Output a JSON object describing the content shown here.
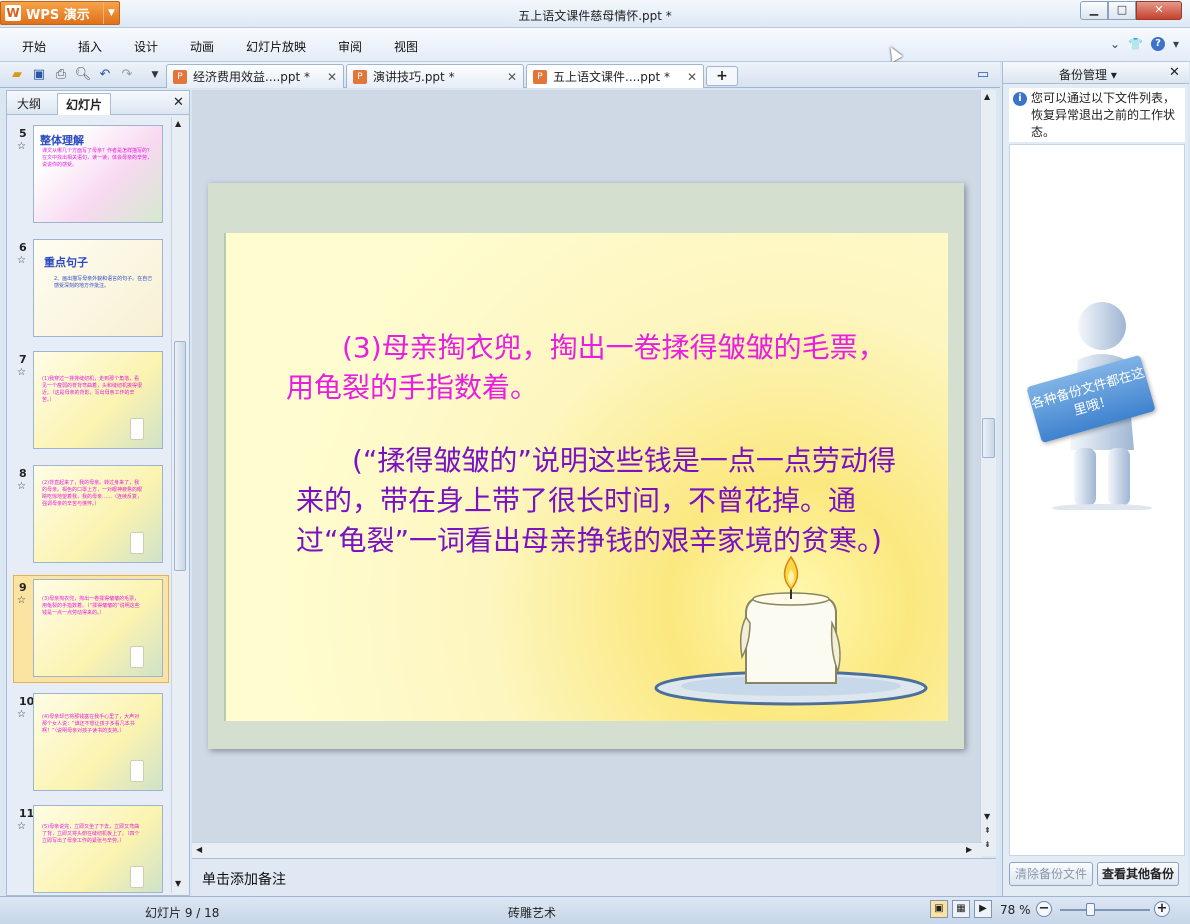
{
  "app": {
    "name": "WPS 演示",
    "document_title": "五上语文课件慈母情怀.ppt *"
  },
  "window_buttons": {
    "minimize": "▁",
    "maximize": "□",
    "close": "✕"
  },
  "menu": [
    "开始",
    "插入",
    "设计",
    "动画",
    "幻灯片放映",
    "审阅",
    "视图"
  ],
  "tabs": [
    {
      "label": "经济费用效益....ppt *"
    },
    {
      "label": "演讲技巧.ppt *"
    },
    {
      "label": "五上语文课件....ppt *"
    }
  ],
  "tab_add": "+",
  "left_pane": {
    "tabs": [
      "大纲",
      "幻灯片"
    ],
    "thumbnails": [
      {
        "number": "5",
        "heading": "整体理解",
        "body": "课文从哪几个方面写了母亲？作者是怎样描写的？在文中找出相关语句，读一读，体会母亲的辛劳，说说你的感受。"
      },
      {
        "number": "6",
        "heading": "重点句子",
        "body": "2、画出描写母亲外貌和语言的句子。在自己感受深刻的地方作批注。"
      },
      {
        "number": "7",
        "heading": "",
        "body": "(1)我穿过一排排缝纫机，走到那个角落，看见一个瘦弱的脊背弯曲着，头和缝纫机挨得很近。（这是母亲的背影，写出母亲工作的辛苦。）"
      },
      {
        "number": "8",
        "heading": "",
        "body": "(2)背直起来了，我的母亲。转过身来了，我的母亲。褐色的口罩上方，一对眼神疲惫的眼睛吃惊地望着我，我的母亲……（连续反复，强调母亲的辛苦与憔悴。）"
      },
      {
        "number": "9",
        "heading": "",
        "body": "(3)母亲掏衣兜，掏出一卷揉得皱皱的毛票，用龟裂的手指数着。（“揉得皱皱的”说明这些钱是一点一点劳动得来的。）"
      },
      {
        "number": "10",
        "heading": "",
        "body": "(4)母亲却已将那钱塞在我手心里了，大声对那个女人说：“谁还不想让孩子多看几本书啊！”（说明母亲对孩子读书的支持。）"
      },
      {
        "number": "11",
        "heading": "",
        "body": "(5)母亲说完，立即又坐了下去，立即又弯曲了背，立即又将头俯在缝纫机板上了。（四个立即写出了母亲工作的紧张与辛劳。）"
      }
    ],
    "star": "☆"
  },
  "slide": {
    "paragraph1": "(3)母亲掏衣兜，掏出一卷揉得皱皱的毛票，用龟裂的手指数着。",
    "paragraph2": "(“揉得皱皱的”说明这些钱是一点一点劳动得来的，带在身上带了很长时间，不曾花掉。通过“龟裂”一词看出母亲挣钱的艰辛家境的贫寒。)"
  },
  "notes_placeholder": "单击添加备注",
  "right_pane": {
    "title": "备份管理",
    "info": "您可以通过以下文件列表，恢复异常退出之前的工作状态。",
    "sign_text": "各种备份文件都在这里哦！",
    "clear_button": "清除备份文件",
    "view_button": "查看其他备份"
  },
  "status": {
    "slide_indicator": "幻灯片 9 / 18",
    "theme": "砖雕艺术",
    "zoom": "78 %",
    "zoom_level_percent": 78
  },
  "colors": {
    "slide_text_pink": "#e81ee0",
    "slide_text_purple": "#7a12c4",
    "accent_orange": "#e0701a"
  }
}
